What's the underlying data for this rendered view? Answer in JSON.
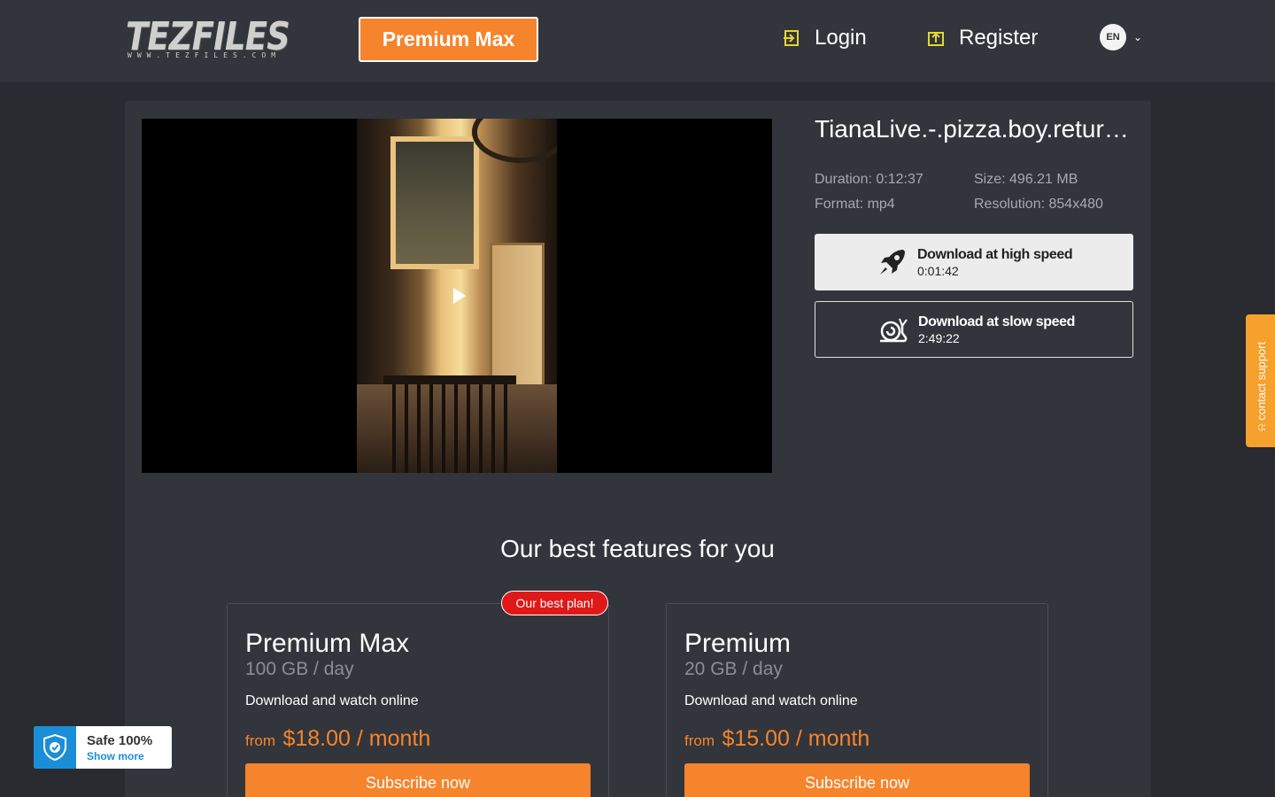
{
  "header": {
    "logo_text": "TEZFILES",
    "logo_url": "WWW.TEZFILES.COM",
    "premium_button": "Premium Max",
    "login_label": "Login",
    "register_label": "Register",
    "language": "EN",
    "icons": {
      "login": "login-icon",
      "register": "register-icon",
      "language_chevron": "chevron-down-icon"
    }
  },
  "file": {
    "title": "TianaLive.-.pizza.boy.retur…",
    "duration": "Duration: 0:12:37",
    "size": "Size: 496.21 MB",
    "format": "Format: mp4",
    "resolution": "Resolution: 854x480"
  },
  "downloads": {
    "high": {
      "label": "Download at high speed",
      "time": "0:01:42",
      "icon": "rocket-icon"
    },
    "slow": {
      "label": "Download at slow speed",
      "time": "2:49:22",
      "icon": "snail-icon"
    }
  },
  "features": {
    "title": "Our best features for you",
    "best_badge": "Our best plan!",
    "plans": [
      {
        "name": "Premium Max",
        "quota": "100 GB / day",
        "desc": "Download and watch online",
        "from": "from",
        "price": "$18.00 / month",
        "cta": "Subscribe now"
      },
      {
        "name": "Premium",
        "quota": "20 GB / day",
        "desc": "Download and watch online",
        "from": "from",
        "price": "$15.00 / month",
        "cta": "Subscribe now"
      }
    ]
  },
  "support": {
    "label": "contact support",
    "icon": "at-icon"
  },
  "safe_badge": {
    "title": "Safe 100%",
    "link": "Show more",
    "icon": "shield-check-icon"
  },
  "colors": {
    "accent": "#f6842d",
    "badge_red": "#e01818",
    "header_bg": "#32353b",
    "page_bg": "#292b30",
    "safe_blue": "#1a8fd8"
  }
}
